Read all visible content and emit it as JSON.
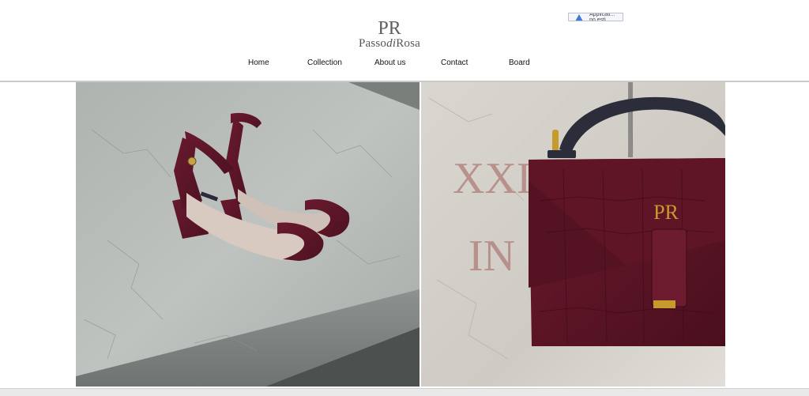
{
  "site": {
    "logo_monogram": "PR",
    "logo_text_prefix": "Passo",
    "logo_text_italic": "di",
    "logo_text_suffix": "Rosa"
  },
  "notice": {
    "text": "Applicati... no esti..."
  },
  "nav": {
    "items": [
      {
        "label": "Home"
      },
      {
        "label": "Collection"
      },
      {
        "label": "About us"
      },
      {
        "label": "Contact"
      },
      {
        "label": "Board"
      }
    ]
  },
  "gallery": {
    "images": [
      {
        "icon": "burgundy-suede-sandals-photo"
      },
      {
        "icon": "burgundy-croc-handbag-photo",
        "wall_text_line1": "XXI",
        "wall_text_line2": "IN",
        "bag_monogram": "PR"
      }
    ]
  },
  "colors": {
    "brand_gray": "#666666",
    "burgundy": "#5e1628",
    "concrete": "#b9bdb9"
  }
}
